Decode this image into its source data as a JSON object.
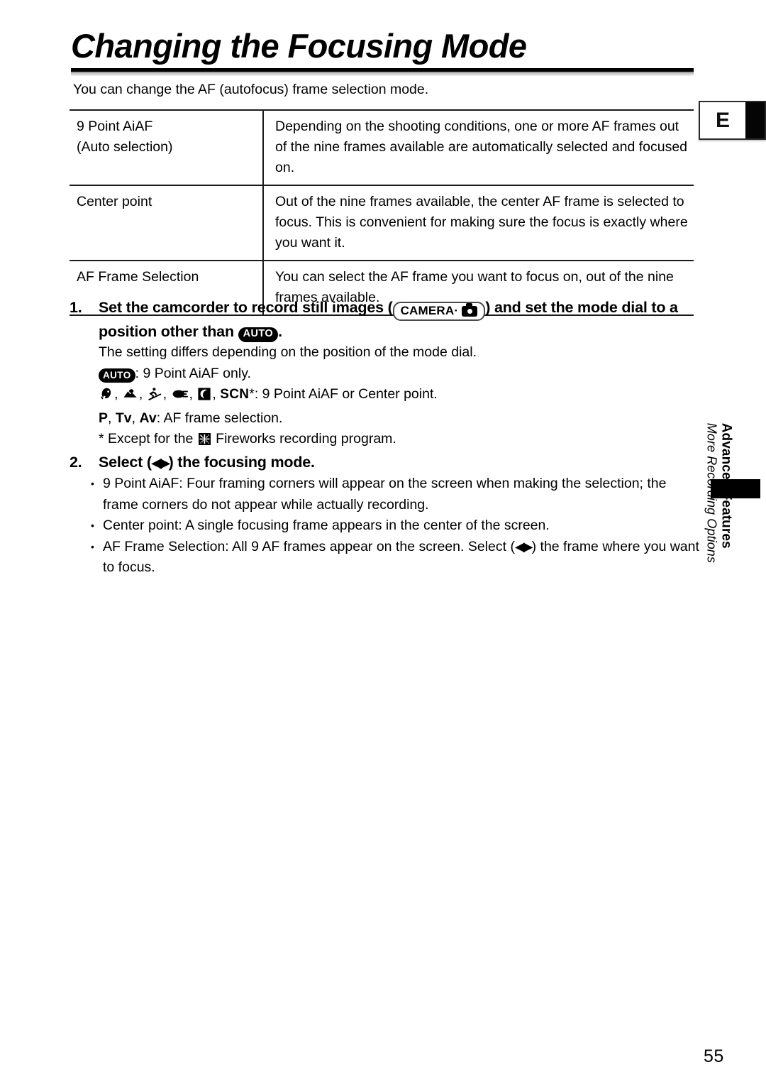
{
  "page": {
    "title": "Changing the Focusing Mode",
    "intro": "You can change the AF (autofocus) frame selection mode.",
    "number": "55",
    "tab_letter": "E"
  },
  "table": {
    "rows": [
      {
        "mode": "9 Point AiAF\n(Auto selection)",
        "mode_line1": "9 Point AiAF",
        "mode_line2": "(Auto selection)",
        "description": "Depending on the shooting conditions, one or more AF frames out of the nine frames available are automatically selected and focused on."
      },
      {
        "mode": "Center point",
        "mode_line1": "Center point",
        "mode_line2": "",
        "description": "Out of the nine frames available, the center AF frame is selected to focus. This is convenient for making sure the focus is exactly where you want it."
      },
      {
        "mode": "AF Frame Selection",
        "mode_line1": "AF Frame Selection",
        "mode_line2": "",
        "description": "You can select the AF frame you want to focus on, out of the nine frames available."
      }
    ]
  },
  "steps": [
    {
      "number": "1.",
      "head_part1": "Set the camcorder to record still images (",
      "badge_camera_label": "CAMERA·",
      "head_part2": ") and set the mode dial to a position other than",
      "badge_auto_label": "AUTO",
      "head_part3": ".",
      "body_line1": "The setting differs depending on the position of the mode dial.",
      "auto_line_badge": "AUTO",
      "auto_line_text": ": 9 Point AiAF only.",
      "scene_icons": [
        "portrait-icon",
        "landscape-icon",
        "sports-icon",
        "spotlight-icon",
        "night-icon"
      ],
      "scn_label": "SCN",
      "scn_star": "*",
      "scene_line_text": ": 9 Point AiAF or Center point.",
      "pav_p": "P",
      "pav_tv": "Tv",
      "pav_av": "Av",
      "pav_text": ": AF frame selection.",
      "footnote_pre": "* Except for the",
      "footnote_icon": "fireworks-icon",
      "footnote_post": "Fireworks recording program."
    },
    {
      "number": "2.",
      "head_part1": "Select (",
      "head_arrows": "◀▶",
      "head_part2": ") the focusing mode.",
      "bullets": [
        "9 Point AiAF: Four framing corners will appear on the screen when making the selection; the frame corners do not appear while actually recording.",
        "Center point: A single focusing frame appears in the center of the screen.",
        "AF Frame Selection: All 9 AF frames appear on the screen. Select (◀▶) the frame where you want to focus."
      ],
      "bullet3_pre": "AF Frame Selection: All 9 AF frames appear on the screen. Select (",
      "bullet3_arrows": "◀▶",
      "bullet3_post": ") the frame where you want to focus.",
      "bullet_dot": "•"
    }
  ],
  "sidebar": {
    "main": "Advanced Features",
    "sub": "More Recording Options"
  }
}
